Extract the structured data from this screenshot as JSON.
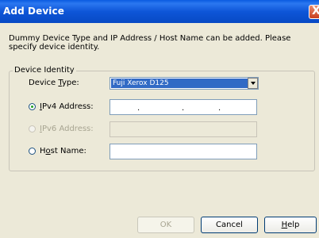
{
  "window": {
    "title": "Add Device",
    "close_glyph": "X"
  },
  "description": "Dummy Device Type and IP Address / Host Name can be added. Please specify device identity.",
  "group": {
    "legend": "Device Identity"
  },
  "device_type": {
    "label_pre": "Device ",
    "label_ul": "T",
    "label_post": "ype:",
    "value": "Fuji Xerox D125"
  },
  "ipv4": {
    "label_ul": "I",
    "label_post": "Pv4 Address:",
    "selected": true,
    "dot": "."
  },
  "ipv6": {
    "label_ul": "I",
    "label_post": "Pv6 Address:",
    "selected": false,
    "enabled": false
  },
  "host": {
    "label_pre": "H",
    "label_ul": "o",
    "label_post": "st Name:",
    "selected": false
  },
  "buttons": {
    "ok": "OK",
    "cancel": "Cancel",
    "help_ul": "H",
    "help_post": "elp"
  }
}
